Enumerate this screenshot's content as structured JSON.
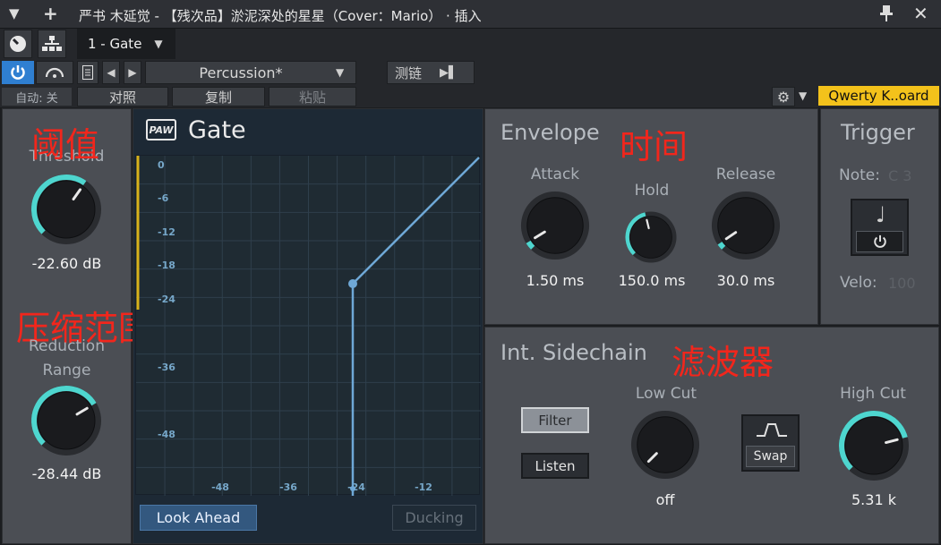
{
  "window": {
    "title": "严书 木延觉 - 【残次品】淤泥深处的星星（Cover：Mario） · 插入"
  },
  "toolbar": {
    "device_selector": "1 - Gate",
    "preset_name": "Percussion*",
    "sidechain_label": "测链",
    "auto_label": "自动: 关",
    "compare_label": "对照",
    "copy_label": "复制",
    "paste_label": "粘贴",
    "keyboard_label": "Qwerty K..oard"
  },
  "annotations": {
    "threshold_cn": "阈值",
    "reduction_cn": "压缩范围",
    "time_cn": "时间",
    "filter_cn": "滤波器"
  },
  "threshold": {
    "label": "Threshold",
    "value": "-22.60 dB",
    "fraction": 0.63
  },
  "reduction": {
    "label1": "Reduction",
    "label2": "Range",
    "value": "-28.44 dB",
    "fraction": 0.72
  },
  "gate": {
    "logo": "PAW",
    "title": "Gate",
    "y_ticks": [
      "0",
      "-6",
      "-12",
      "-18",
      "-24",
      "-36",
      "-48"
    ],
    "x_ticks": [
      "-48",
      "-36",
      "-24",
      "-12"
    ],
    "look_ahead": "Look Ahead",
    "ducking": "Ducking"
  },
  "envelope": {
    "heading": "Envelope",
    "attack": {
      "label": "Attack",
      "value": "1.50 ms",
      "fraction": 0.05
    },
    "hold": {
      "label": "Hold",
      "value": "150.0 ms",
      "fraction": 0.45
    },
    "release": {
      "label": "Release",
      "value": "30.0 ms",
      "fraction": 0.04
    }
  },
  "trigger": {
    "heading": "Trigger",
    "note_label": "Note:",
    "note_value": "C 3",
    "velo_label": "Velo:",
    "velo_value": "100"
  },
  "sidechain": {
    "heading": "Int. Sidechain",
    "filter_btn": "Filter",
    "listen_btn": "Listen",
    "swap_btn": "Swap",
    "low_cut": {
      "label": "Low Cut",
      "value": "off",
      "fraction": 0.0
    },
    "high_cut": {
      "label": "High Cut",
      "value": "5.31 k",
      "fraction": 0.78
    }
  },
  "colors": {
    "accent": "#4ed6cf",
    "brand_blue": "#2f7fd1",
    "graph_line": "#6fa8d6",
    "keyboard_bg": "#f3c21b"
  }
}
